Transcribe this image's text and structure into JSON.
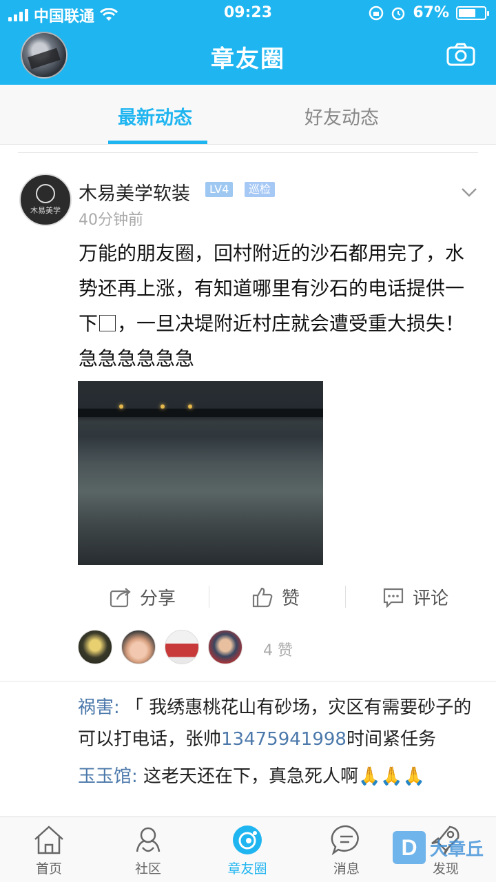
{
  "status_bar": {
    "carrier": "中国联通",
    "time": "09:23",
    "battery": "67%",
    "battery_level": 0.67
  },
  "header": {
    "title": "章友圈"
  },
  "tabs": [
    {
      "label": "最新动态",
      "active": true
    },
    {
      "label": "好友动态",
      "active": false
    }
  ],
  "post": {
    "author": "木易美学软装",
    "level_badge": "LV4",
    "role_badge": "巡检",
    "avatar_text": "木易美学",
    "time": "40分钟前",
    "text_before_box": "万能的朋友圈，回村附近的沙石都用完了，水势还再上涨，有知道哪里有沙石的电话提供一下",
    "text_after_box": "，一旦决堤附近村庄就会遭受重大损失！急急急急急急",
    "actions": {
      "share": "分享",
      "like": "赞",
      "comment": "评论"
    },
    "like_count": "4 赞"
  },
  "comments": [
    {
      "author": "祸害:",
      "text_before_phone": " 「 我绣惠桃花山有砂场，灾区有需要砂子的可以打电话，张帅",
      "phone": "13475941998",
      "text_after_phone": "时间紧任务"
    },
    {
      "author": "玉玉馆:",
      "text": " 这老天还在下，真急死人啊",
      "emoji": "🙏🙏🙏"
    }
  ],
  "bottom_nav": [
    {
      "label": "首页",
      "icon": "home-icon",
      "active": false
    },
    {
      "label": "社区",
      "icon": "community-icon",
      "active": false
    },
    {
      "label": "章友圈",
      "icon": "moments-icon",
      "active": true
    },
    {
      "label": "消息",
      "icon": "message-icon",
      "active": false
    },
    {
      "label": "发现",
      "icon": "discover-icon",
      "active": false
    }
  ],
  "watermark": {
    "logo": "D",
    "text": "大章丘"
  },
  "colors": {
    "brand_blue": "#1fb5f0",
    "link_blue": "#4c79ab"
  }
}
